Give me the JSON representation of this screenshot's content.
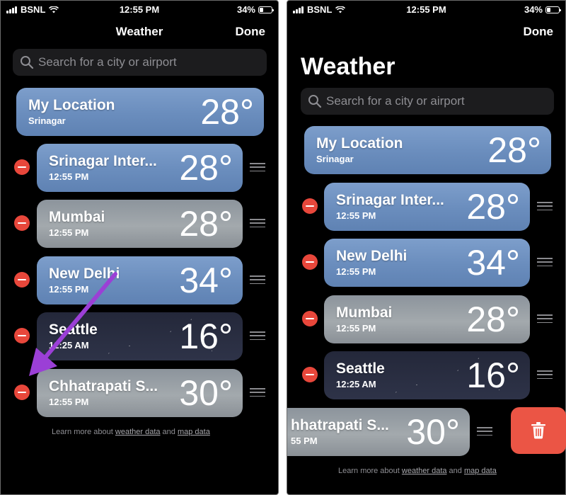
{
  "status": {
    "carrier": "BSNL",
    "time": "12:55 PM",
    "battery": "34%"
  },
  "left": {
    "nav_title": "Weather",
    "done": "Done",
    "search_placeholder": "Search for a city or airport",
    "my_location": {
      "title": "My Location",
      "subtitle": "Srinagar",
      "temp": "28°"
    },
    "cities": [
      {
        "name": "Srinagar Inter...",
        "time": "12:55 PM",
        "temp": "28°"
      },
      {
        "name": "Mumbai",
        "time": "12:55 PM",
        "temp": "28°"
      },
      {
        "name": "New Delhi",
        "time": "12:55 PM",
        "temp": "34°"
      },
      {
        "name": "Seattle",
        "time": "12:25 AM",
        "temp": "16°"
      },
      {
        "name": "Chhatrapati S...",
        "time": "12:55 PM",
        "temp": "30°"
      }
    ],
    "footer": {
      "prefix": "Learn more about ",
      "link1": "weather data",
      "mid": " and ",
      "link2": "map data"
    }
  },
  "right": {
    "done": "Done",
    "big_title": "Weather",
    "search_placeholder": "Search for a city or airport",
    "my_location": {
      "title": "My Location",
      "subtitle": "Srinagar",
      "temp": "28°"
    },
    "cities": [
      {
        "name": "Srinagar Inter...",
        "time": "12:55 PM",
        "temp": "28°"
      },
      {
        "name": "New Delhi",
        "time": "12:55 PM",
        "temp": "34°"
      },
      {
        "name": "Mumbai",
        "time": "12:55 PM",
        "temp": "28°"
      },
      {
        "name": "Seattle",
        "time": "12:25 AM",
        "temp": "16°"
      },
      {
        "name": "hhatrapati S...",
        "time": "55 PM",
        "temp": "30°"
      }
    ],
    "footer": {
      "prefix": "Learn more about ",
      "link1": "weather data",
      "mid": " and ",
      "link2": "map data"
    }
  },
  "colors": {
    "delete_red": "#eb5545",
    "minus_red": "#e8473b",
    "arrow": "#9b3fd6"
  },
  "icons": {
    "delete": "trash-icon",
    "remove": "minus-circle-icon",
    "reorder": "grip-lines-icon",
    "search": "magnifier-icon"
  }
}
